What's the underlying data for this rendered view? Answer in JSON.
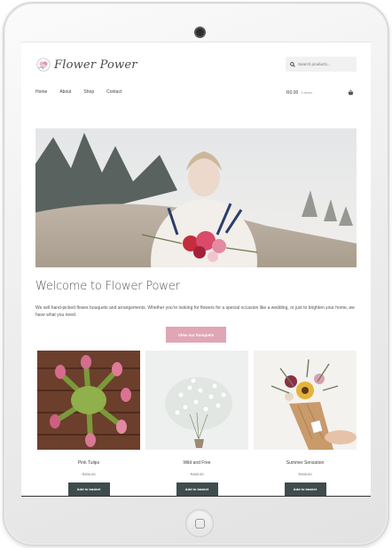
{
  "site": {
    "logo_text": "Flower Power"
  },
  "search": {
    "placeholder": "Search products..."
  },
  "nav": {
    "items": [
      "Home",
      "About",
      "Shop",
      "Contact"
    ]
  },
  "cart": {
    "total": "R0.00",
    "count": "0 items"
  },
  "hero": {
    "icon": "bride-with-bouquet-photo"
  },
  "welcome": {
    "title": "Welcome to Flower Power",
    "text": "We sell hand-picked flower bouquets and arrangements. Whether you're looking for flowers for a special occasion like a wedding, or just to brighten your home, we have what you need.",
    "button": "View our bouquets"
  },
  "products": [
    {
      "name": "Pink Tulips",
      "price": "R400.00",
      "button": "Add to basket",
      "icon": "pink-tulips-photo"
    },
    {
      "name": "Wild and Free",
      "price": "R450.00",
      "button": "Add to basket",
      "icon": "white-flowers-photo"
    },
    {
      "name": "Summer Sensation",
      "price": "R490.00",
      "button": "Add to basket",
      "icon": "sunflower-bouquet-photo"
    }
  ],
  "colors": {
    "accent_pink": "#e0a6b5",
    "button_dark": "#3f4c4e"
  }
}
